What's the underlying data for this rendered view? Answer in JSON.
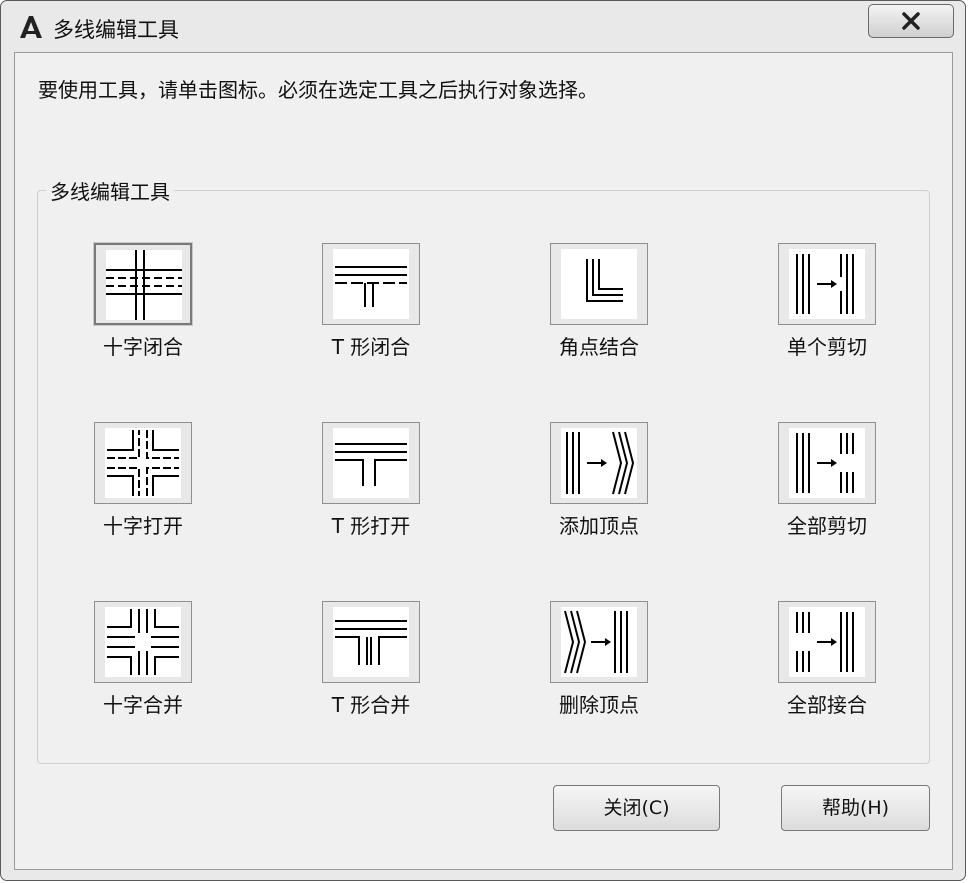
{
  "window": {
    "title": "多线编辑工具",
    "close_icon": "close-icon",
    "app_icon": "autocad-icon"
  },
  "instruction": "要使用工具，请单击图标。必须在选定工具之后执行对象选择。",
  "group": {
    "label": "多线编辑工具",
    "tools": [
      {
        "label": "十字闭合",
        "icon": "closed-cross-icon",
        "selected": true
      },
      {
        "label": "T 形闭合",
        "icon": "closed-tee-icon",
        "selected": false
      },
      {
        "label": "角点结合",
        "icon": "corner-joint-icon",
        "selected": false
      },
      {
        "label": "单个剪切",
        "icon": "cut-single-icon",
        "selected": false
      },
      {
        "label": "十字打开",
        "icon": "open-cross-icon",
        "selected": false
      },
      {
        "label": "T 形打开",
        "icon": "open-tee-icon",
        "selected": false
      },
      {
        "label": "添加顶点",
        "icon": "add-vertex-icon",
        "selected": false
      },
      {
        "label": "全部剪切",
        "icon": "cut-all-icon",
        "selected": false
      },
      {
        "label": "十字合并",
        "icon": "merged-cross-icon",
        "selected": false
      },
      {
        "label": "T 形合并",
        "icon": "merged-tee-icon",
        "selected": false
      },
      {
        "label": "删除顶点",
        "icon": "delete-vertex-icon",
        "selected": false
      },
      {
        "label": "全部接合",
        "icon": "weld-all-icon",
        "selected": false
      }
    ]
  },
  "buttons": {
    "close": "关闭(C)",
    "help": "帮助(H)"
  }
}
